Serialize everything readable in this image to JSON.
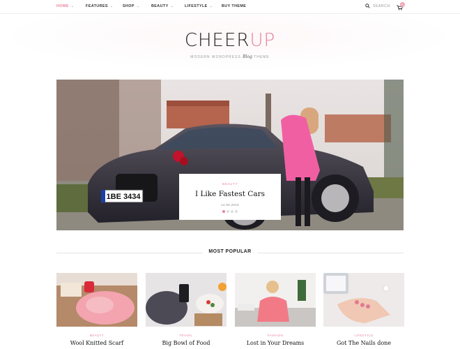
{
  "nav": {
    "items": [
      {
        "label": "HOME",
        "active": true,
        "has_caret": true
      },
      {
        "label": "FEATURES",
        "active": false,
        "has_caret": true
      },
      {
        "label": "SHOP",
        "active": false,
        "has_caret": true
      },
      {
        "label": "BEAUTY",
        "active": false,
        "has_caret": true
      },
      {
        "label": "LIFESTYLE",
        "active": false,
        "has_caret": true
      },
      {
        "label": "BUY THEME",
        "active": false,
        "has_caret": false
      }
    ],
    "search_label": "SEARCH",
    "search_icon": "search-icon",
    "cart_icon": "cart-icon",
    "cart_count": "0"
  },
  "brand": {
    "logo_dark": "CHEER",
    "logo_accent": "UP",
    "tagline_before": "MODERN WORDPRESS",
    "tagline_script": "Blog",
    "tagline_after": "THEME"
  },
  "hero": {
    "category": "BEAUTY",
    "title": "I Like Fastest Cars",
    "date": "14.05.2016",
    "plate_text": "1BE 3434",
    "slide_count": 4,
    "active_slide": 1
  },
  "popular": {
    "heading": "MOST POPULAR",
    "posts": [
      {
        "category": "BEAUTY",
        "title": "Wool Knitted Scarf"
      },
      {
        "category": "TRAVEL",
        "title": "Big Bowl of Food"
      },
      {
        "category": "FASHION",
        "title": "Lost in Your Dreams"
      },
      {
        "category": "LIFESTYLE",
        "title": "Got The Nails done"
      }
    ]
  },
  "colors": {
    "accent": "#e8839a",
    "text": "#222222",
    "muted": "#999999"
  }
}
